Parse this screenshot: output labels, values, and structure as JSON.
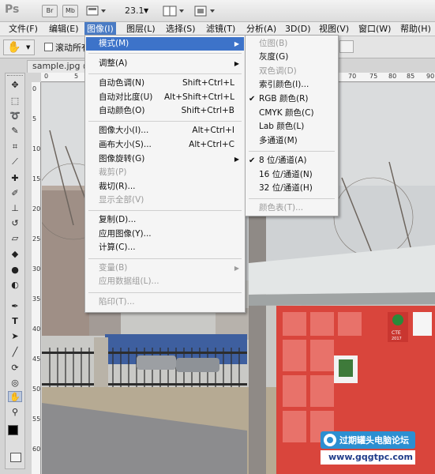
{
  "app": {
    "logo": "Ps",
    "toolbar_buttons": [
      "Br",
      "Mb"
    ],
    "zoom": "23.1"
  },
  "menubar": {
    "items": [
      "文件(F)",
      "编辑(E)",
      "图像(I)",
      "图层(L)",
      "选择(S)",
      "滤镜(T)",
      "分析(A)",
      "3D(D)",
      "视图(V)",
      "窗口(W)",
      "帮助(H)"
    ],
    "active_index": 2
  },
  "options_bar": {
    "checkbox_label": "滚动所有"
  },
  "document": {
    "tab_title": "sample.jpg @",
    "ruler_top_numbers": [
      "0",
      "5",
      "70",
      "75",
      "80",
      "85",
      "90"
    ],
    "ruler_left_numbers": [
      "0",
      "5",
      "10",
      "15",
      "20",
      "25",
      "30",
      "35",
      "40",
      "45",
      "50",
      "55",
      "60"
    ]
  },
  "image_menu": {
    "items": [
      {
        "label": "模式(M)",
        "shortcut": "",
        "submenu": true,
        "disabled": false,
        "highlighted": true
      },
      {
        "sep": true
      },
      {
        "label": "调整(A)",
        "shortcut": "",
        "submenu": true,
        "disabled": false
      },
      {
        "sep": true
      },
      {
        "label": "自动色调(N)",
        "shortcut": "Shift+Ctrl+L",
        "disabled": false
      },
      {
        "label": "自动对比度(U)",
        "shortcut": "Alt+Shift+Ctrl+L",
        "disabled": false
      },
      {
        "label": "自动颜色(O)",
        "shortcut": "Shift+Ctrl+B",
        "disabled": false
      },
      {
        "sep": true
      },
      {
        "label": "图像大小(I)...",
        "shortcut": "Alt+Ctrl+I",
        "disabled": false
      },
      {
        "label": "画布大小(S)...",
        "shortcut": "Alt+Ctrl+C",
        "disabled": false
      },
      {
        "label": "图像旋转(G)",
        "shortcut": "",
        "submenu": true,
        "disabled": false
      },
      {
        "label": "裁剪(P)",
        "shortcut": "",
        "disabled": true
      },
      {
        "label": "裁切(R)...",
        "shortcut": "",
        "disabled": false
      },
      {
        "label": "显示全部(V)",
        "shortcut": "",
        "disabled": true
      },
      {
        "sep": true
      },
      {
        "label": "复制(D)...",
        "shortcut": "",
        "disabled": false
      },
      {
        "label": "应用图像(Y)...",
        "shortcut": "",
        "disabled": false
      },
      {
        "label": "计算(C)...",
        "shortcut": "",
        "disabled": false
      },
      {
        "sep": true
      },
      {
        "label": "变量(B)",
        "shortcut": "",
        "submenu": true,
        "disabled": true
      },
      {
        "label": "应用数据组(L)...",
        "shortcut": "",
        "disabled": true
      },
      {
        "sep": true
      },
      {
        "label": "陷印(T)...",
        "shortcut": "",
        "disabled": true
      }
    ]
  },
  "mode_menu": {
    "items": [
      {
        "label": "位图(B)",
        "disabled": true
      },
      {
        "label": "灰度(G)",
        "disabled": false
      },
      {
        "label": "双色调(D)",
        "disabled": true
      },
      {
        "label": "索引颜色(I)...",
        "disabled": false
      },
      {
        "label": "RGB 颜色(R)",
        "disabled": false,
        "checked": true
      },
      {
        "label": "CMYK 颜色(C)",
        "disabled": false
      },
      {
        "label": "Lab 颜色(L)",
        "disabled": false
      },
      {
        "label": "多通道(M)",
        "disabled": false
      },
      {
        "sep": true
      },
      {
        "label": "8 位/通道(A)",
        "disabled": false,
        "checked": true
      },
      {
        "label": "16 位/通道(N)",
        "disabled": false
      },
      {
        "label": "32 位/通道(H)",
        "disabled": false
      },
      {
        "sep": true
      },
      {
        "label": "颜色表(T)...",
        "disabled": true
      }
    ]
  },
  "watermark": {
    "title": "过期罐头电脑论坛",
    "url": "www.gqgtpc.com"
  },
  "photo_sign": {
    "label": "CTE",
    "year": "2017"
  },
  "colors": {
    "menu_highlight": "#3d73c9",
    "menubar_active": "#4a7bc4",
    "locker_red": "#d9453c"
  }
}
